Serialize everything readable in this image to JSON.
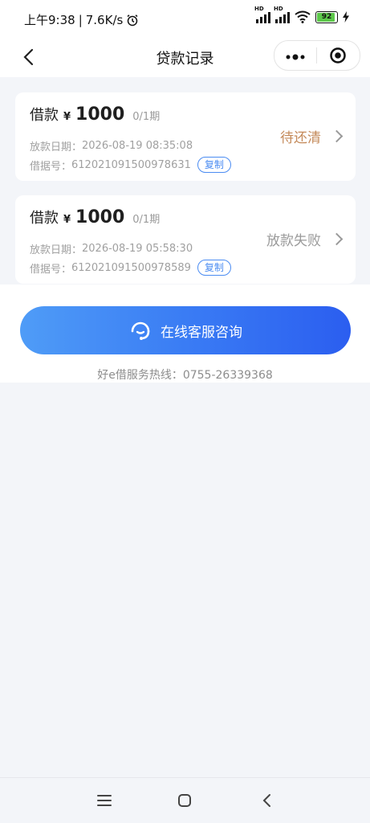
{
  "status_bar": {
    "time": "上午9:38",
    "net_speed": "7.6K/s",
    "battery": "92"
  },
  "nav": {
    "title": "贷款记录",
    "more_icon": "more-dots-icon",
    "target_icon": "target-icon"
  },
  "loans": [
    {
      "label": "借款",
      "currency": "¥",
      "amount": "1000",
      "term": "0/1期",
      "date_label": "放款日期：",
      "date_value": "2026-08-19 08:35:08",
      "id_label": "借据号：",
      "id_value": "612021091500978631",
      "copy_label": "复制",
      "status": "待还清",
      "status_color": "#c48a5a"
    },
    {
      "label": "借款",
      "currency": "¥",
      "amount": "1000",
      "term": "0/1期",
      "date_label": "放款日期：",
      "date_value": "2026-08-19 05:58:30",
      "id_label": "借据号：",
      "id_value": "612021091500978589",
      "copy_label": "复制",
      "status": "放款失败",
      "status_color": "#9a9a9a"
    }
  ],
  "cta": {
    "label": "在线客服咨询",
    "icon": "customer-service-icon"
  },
  "hotline": "好e借服务热线：0755-26339368",
  "colors": {
    "accent": "#3a7cf4",
    "pending": "#c48a5a",
    "failed": "#9a9a9a"
  }
}
